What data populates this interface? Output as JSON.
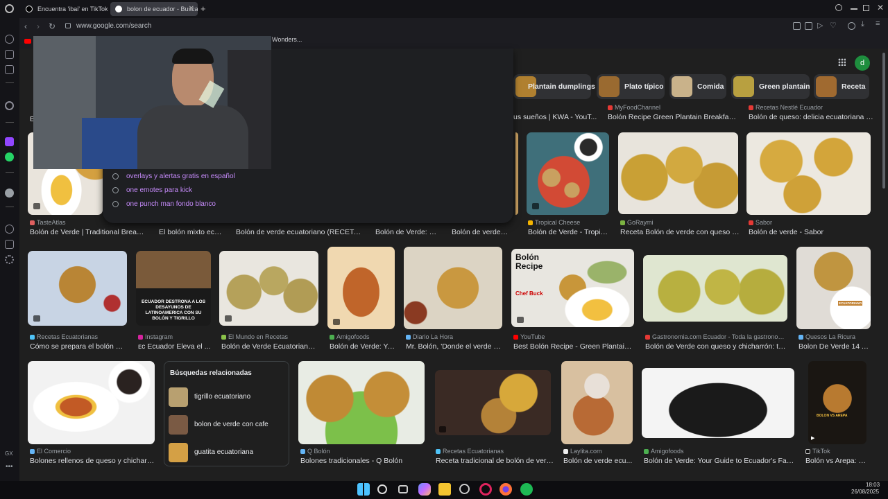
{
  "tabs": [
    {
      "label": "Encuentra 'ibai' en TikTok"
    },
    {
      "label": "bolon de ecuador - Buscar"
    }
  ],
  "address": {
    "url": "www.google.com/search"
  },
  "bookmarks": {
    "item": "Wonders..."
  },
  "header": {
    "avatar_letter": "d"
  },
  "suggestions": [
    {
      "text": "overlays y alertas gratis en español"
    },
    {
      "text": "one emotes para kick"
    },
    {
      "text": "one punch man fondo blanco"
    }
  ],
  "chips": [
    {
      "label": "Plantain dumplings"
    },
    {
      "label": "Plato típico"
    },
    {
      "label": "Comida"
    },
    {
      "label": "Green plantain"
    },
    {
      "label": "Receta"
    }
  ],
  "row0": [
    {
      "title": "B"
    },
    {
      "title": "us sueños | KWA - YouT..."
    },
    {
      "source": "MyFoodChannel",
      "title": "Bolón Recipe Green Plantain Breakfast -..."
    },
    {
      "source": "Recetas Nestlé Ecuador",
      "title": "Bolón de queso: delicia ecuatoriana | ..."
    }
  ],
  "row1": [
    {
      "source": "TasteAtlas",
      "title": "Bolón de Verde | Traditional Breakfa..."
    },
    {
      "title": "El bolón mixto ecu..."
    },
    {
      "title": "Bolón de verde ecuatoriano (RECETA) -..."
    },
    {
      "title": "Bolón de Verde: D..."
    },
    {
      "title": "Bolón de verde ec..."
    },
    {
      "source": "Tropical Cheese",
      "title": "Bolón de Verde - Tropic..."
    },
    {
      "source": "GoRaymi",
      "title": "Receta Bolón de verde con queso y ..."
    },
    {
      "source": "Sabor",
      "title": "Bolón de verde - Sabor"
    }
  ],
  "row2": [
    {
      "source": "Recetas Ecuatorianas",
      "title": "Cómo se prepara el bolón de ..."
    },
    {
      "source": "Instagram",
      "title": "ᴇᴄ Ecuador Eleva el ...",
      "overlay": "ECUADOR DESTRONA A LOS DESAYUNOS DE LATINOAMERICA CON SU BOLÓN Y TIGRILLO"
    },
    {
      "source": "El Mundo en Recetas",
      "title": "Bolón de Verde Ecuatoriano |..."
    },
    {
      "source": "Amigofoods",
      "title": "Bolón de Verde: Yo..."
    },
    {
      "source": "Diario La Hora",
      "title": "Mr. Bolón, 'Donde el verde sa..."
    },
    {
      "source": "YouTube",
      "title": "Best Bolón Recipe - Green Plantain B...",
      "overlay": "Bolón Recipe",
      "overlay2": "Chef Buck"
    },
    {
      "source": "Gastronomia.com Ecuador - Toda la gastronomía ...",
      "title": "Bolón de Verde con queso y chicharrón: tradi..."
    },
    {
      "source": "Quesos La Ricura",
      "title": "Bolon De Verde 14 A...",
      "overlay": "ECUATORIANO"
    }
  ],
  "row3": [
    {
      "source": "El Comercio",
      "title": "Bolones rellenos de queso y chicharró..."
    },
    {
      "source": "Q Bolón",
      "title": "Bolones tradicionales - Q Bolón"
    },
    {
      "source": "Recetas Ecuatorianas",
      "title": "Receta tradicional de bolón de verde"
    },
    {
      "source": "Laylita.com",
      "title": "Bolón de verde ecu..."
    },
    {
      "source": "Amigofoods",
      "title": "Bolón de Verde: Your Guide to Ecuador's Favori..."
    },
    {
      "source": "TikTok",
      "title": "Bolón vs Arepa: R...",
      "overlay": "BOLON VS AREPA"
    }
  ],
  "related": {
    "heading": "Búsquedas relacionadas",
    "items": [
      {
        "label": "tigrillo ecuatoriano"
      },
      {
        "label": "bolon de verde con cafe"
      },
      {
        "label": "guatita ecuatoriana"
      }
    ]
  },
  "sidebar_label": "GX",
  "clock": {
    "time": "18:03",
    "date": "26/08/2025"
  },
  "colors": {
    "accent": "#c58af9",
    "avatar": "#1e8e3e",
    "browser_bg": "#141418",
    "page_bg": "#1f1f1f"
  }
}
